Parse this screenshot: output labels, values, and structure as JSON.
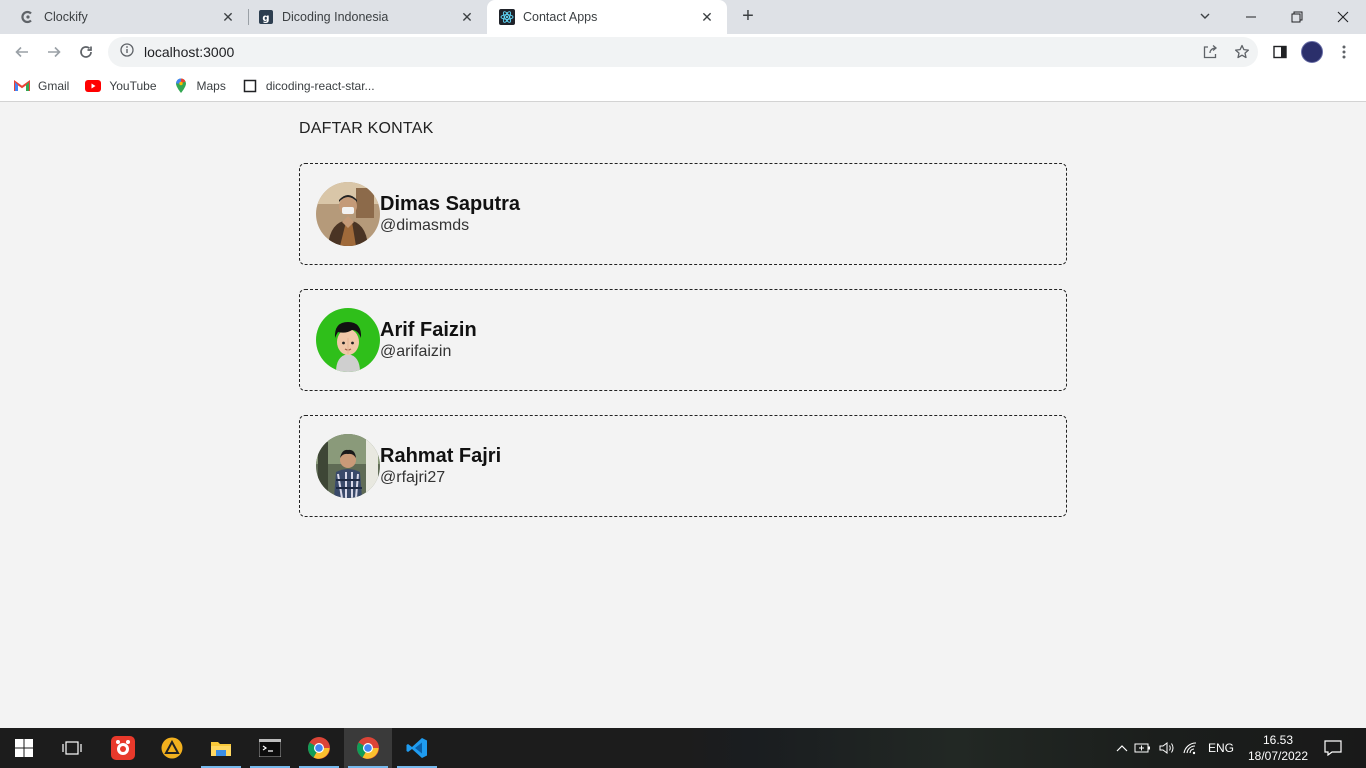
{
  "browser": {
    "tabs": [
      {
        "title": "Clockify",
        "icon": "clockify-icon",
        "active": false
      },
      {
        "title": "Dicoding Indonesia",
        "icon": "dicoding-icon",
        "active": false
      },
      {
        "title": "Contact Apps",
        "icon": "react-icon",
        "active": true
      }
    ],
    "address": "localhost:3000",
    "bookmarks": [
      {
        "label": "Gmail",
        "icon": "gmail-icon"
      },
      {
        "label": "YouTube",
        "icon": "youtube-icon"
      },
      {
        "label": "Maps",
        "icon": "maps-icon"
      },
      {
        "label": "dicoding-react-star...",
        "icon": "bookmark-page-icon"
      }
    ]
  },
  "page": {
    "title": "DAFTAR KONTAK",
    "contacts": [
      {
        "name": "Dimas Saputra",
        "username": "@dimasmds"
      },
      {
        "name": "Arif Faizin",
        "username": "@arifaizin"
      },
      {
        "name": "Rahmat Fajri",
        "username": "@rfajri27"
      }
    ]
  },
  "taskbar": {
    "language": "ENG",
    "time": "16.53",
    "date": "18/07/2022"
  },
  "colors": {
    "page_bg": "#f3f3f3",
    "tabstrip_bg": "#dee1e6",
    "taskbar_bg": "#1c1c1c",
    "accent_green": "#2fbf1a"
  }
}
